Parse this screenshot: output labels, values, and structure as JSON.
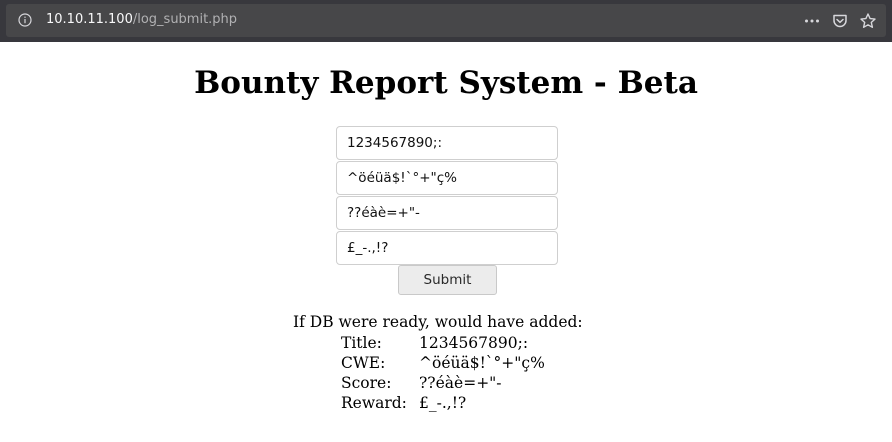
{
  "browser": {
    "url_host": "10.10.11.100",
    "url_path": "/log_submit.php"
  },
  "page": {
    "title": "Bounty Report System - Beta"
  },
  "form": {
    "fields": [
      {
        "name": "title",
        "value": "1234567890;:"
      },
      {
        "name": "cwe",
        "value": "^öéüä$!`°+\"ç%"
      },
      {
        "name": "score",
        "value": "??éàè=+\"-"
      },
      {
        "name": "reward",
        "value": "£_-.,!?"
      }
    ],
    "submit_label": "Submit"
  },
  "result": {
    "header": "If DB were ready, would have added:",
    "rows": [
      {
        "label": "Title:",
        "value": "1234567890;:"
      },
      {
        "label": "CWE:",
        "value": "^öéüä$!`°+\"ç%"
      },
      {
        "label": "Score:",
        "value": "??éàè=+\"-"
      },
      {
        "label": "Reward:",
        "value": "£_-.,!?"
      }
    ]
  }
}
